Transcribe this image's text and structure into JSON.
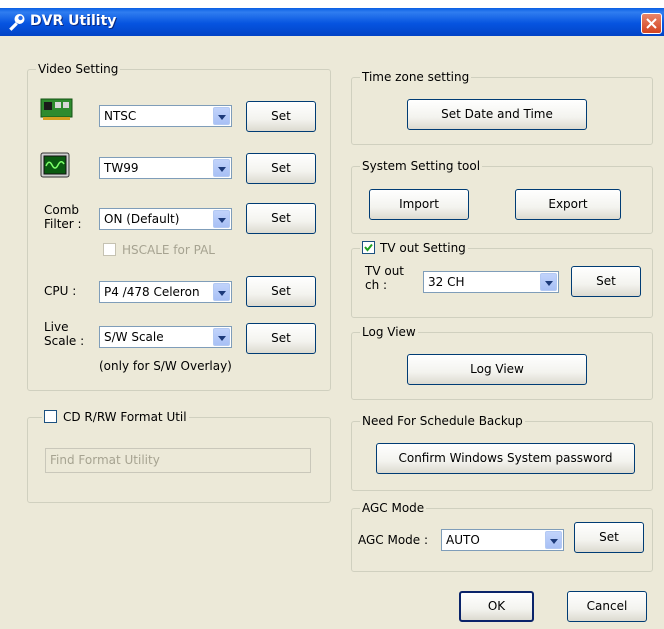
{
  "window": {
    "title": "DVR Utility"
  },
  "video_setting": {
    "label": "Video Setting",
    "video_standard": {
      "value": "NTSC",
      "set_label": "Set"
    },
    "decoder": {
      "value": "TW99",
      "set_label": "Set"
    },
    "comb_filter": {
      "label": "Comb Filter :",
      "value": "ON (Default)",
      "set_label": "Set"
    },
    "hscale": {
      "label": "HSCALE for PAL",
      "checked": false
    },
    "cpu": {
      "label": "CPU :",
      "value": "P4 /478 Celeron",
      "set_label": "Set"
    },
    "live_scale": {
      "label": "Live Scale :",
      "value": "S/W Scale",
      "set_label": "Set",
      "note": "(only for S/W Overlay)"
    }
  },
  "cd_format": {
    "label": "CD R/RW Format Util",
    "checked": false,
    "placeholder": "Find Format Utility"
  },
  "time_zone": {
    "label": "Time zone setting",
    "button": "Set Date and Time"
  },
  "system_tool": {
    "label": "System Setting tool",
    "import_label": "Import",
    "export_label": "Export"
  },
  "tv_out": {
    "label": "TV out Setting",
    "checked": true,
    "channel_label": "TV out ch :",
    "value": "32 CH",
    "set_label": "Set"
  },
  "log_view": {
    "label": "Log View",
    "button": "Log View"
  },
  "schedule_backup": {
    "label": "Need For Schedule Backup",
    "button": "Confirm Windows System password"
  },
  "agc": {
    "label": "AGC Mode",
    "field_label": "AGC Mode :",
    "value": "AUTO",
    "set_label": "Set"
  },
  "footer": {
    "ok_label": "OK",
    "cancel_label": "Cancel"
  }
}
